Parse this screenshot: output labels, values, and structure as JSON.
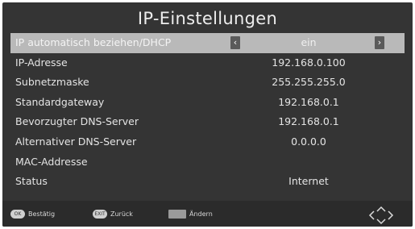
{
  "title": "IP-Einstellungen",
  "rows": [
    {
      "label": "IP automatisch beziehen/DHCP",
      "value": "ein"
    },
    {
      "label": "IP-Adresse",
      "value": "192.168.0.100"
    },
    {
      "label": "Subnetzmaske",
      "value": "255.255.255.0"
    },
    {
      "label": "Standardgateway",
      "value": "192.168.0.1"
    },
    {
      "label": "Bevorzugter DNS-Server",
      "value": "192.168.0.1"
    },
    {
      "label": "Alternativer DNS-Server",
      "value": "0.0.0.0"
    },
    {
      "label": "MAC-Addresse",
      "value": ""
    },
    {
      "label": "Status",
      "value": "Internet"
    }
  ],
  "arrows": {
    "left": "‹",
    "right": "›"
  },
  "footer": {
    "confirm_key": "OK",
    "confirm": "Bestätig",
    "back_key": "EXIT",
    "back": "Zurück",
    "change": "Ändern"
  },
  "colors": {
    "background": "#343434",
    "selected_row": "#b9b9b9",
    "text": "#e4e4e4"
  },
  "icons": {
    "navigation": "dpad-arrows-icon"
  }
}
